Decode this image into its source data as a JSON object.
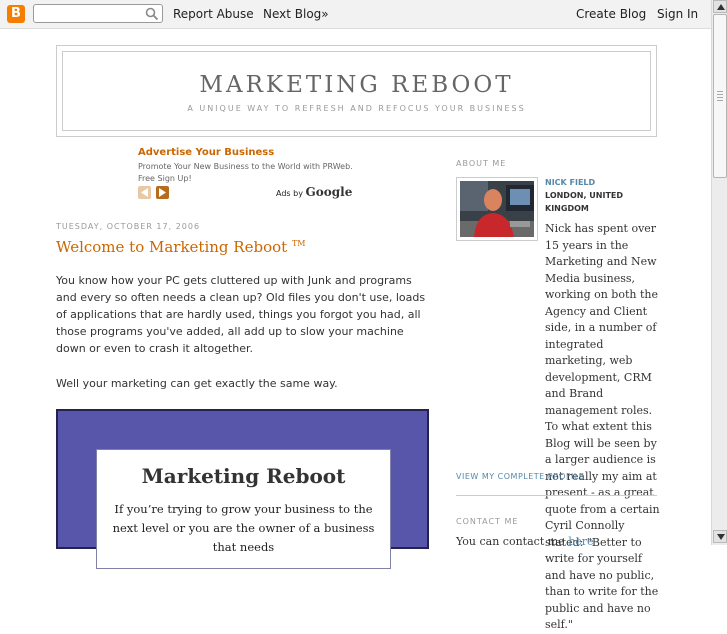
{
  "navbar": {
    "search": {
      "value": "",
      "placeholder": ""
    },
    "report_abuse": "Report Abuse",
    "next_blog": "Next Blog»",
    "create_blog": "Create Blog",
    "sign_in": "Sign In",
    "logo_letter": "B",
    "logo_color": "#f57d00"
  },
  "header": {
    "title": "MARKETING REBOOT",
    "description": "A UNIQUE WAY TO REFRESH AND REFOCUS YOUR BUSINESS"
  },
  "ad": {
    "title": "Advertise Your Business",
    "text": "Promote Your New Business to the World with PRWeb. Free Sign Up!",
    "ads_by_prefix": "Ads by",
    "ads_by_brand": "Google"
  },
  "post": {
    "date": "TUESDAY, OCTOBER 17, 2006",
    "title": "Welcome to Marketing Reboot",
    "title_mark": "TM",
    "para1": "You know how your PC gets cluttered up with Junk and programs and every so often needs a clean up? Old files you don't use, loads of applications that are hardly used, things you forgot you had, all those programs you've added, all add up to slow your machine down or even to crash it altogether.",
    "para2": "Well your marketing can get exactly the same way.",
    "image": {
      "title": "Marketing Reboot",
      "body": "If you’re trying to grow your business to the next level or you are the owner of a business that needs"
    }
  },
  "sidebar": {
    "about_heading": "ABOUT ME",
    "profile_name": "NICK FIELD",
    "profile_location": "LONDON, UNITED KINGDOM",
    "bio": "Nick has spent over 15 years in the Marketing and New Media business, working on both the Agency and Client side, in a number of integrated marketing, web development, CRM and Brand management roles. To what extent this Blog will be seen by a larger audience is not really my aim at present - as a great quote from a certain Cyril Connolly stated: \"Better to write for yourself and have no public, than to write for the public and have no self.\"",
    "profile_link": "VIEW MY COMPLETE PROFILE",
    "contact_heading": "CONTACT ME",
    "contact_text": "You can contact me",
    "contact_link": "here"
  },
  "colors": {
    "accent": "#cc6600",
    "link": "#5588aa",
    "promo_background": "#5756ab"
  }
}
